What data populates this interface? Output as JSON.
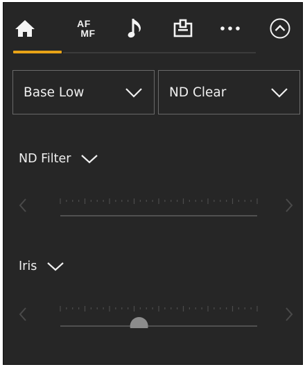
{
  "tabs": [
    {
      "id": "home",
      "icon": "home-icon",
      "active": true
    },
    {
      "id": "focus",
      "icon": "af-mf-icon",
      "text_top": "AF",
      "text_bottom": "MF",
      "active": false
    },
    {
      "id": "audio",
      "icon": "music-note-icon",
      "active": false
    },
    {
      "id": "media",
      "icon": "media-slot-icon",
      "active": false
    },
    {
      "id": "more",
      "icon": "more-dots-icon",
      "active": false
    }
  ],
  "collapse_icon": "chevron-up-circle-icon",
  "colors": {
    "panel_bg": "#262626",
    "accent": "#e8a317",
    "text": "#f0f0f0",
    "border": "#6a6a6a",
    "knob": "#8c8c8c"
  },
  "dropdowns": {
    "sensitivity": {
      "value": "Base Low"
    },
    "nd_mode": {
      "value": "ND Clear"
    }
  },
  "nd_filter": {
    "label": "ND Filter",
    "slider_has_knob": false
  },
  "iris": {
    "label": "Iris",
    "position_fraction": 0.4
  }
}
